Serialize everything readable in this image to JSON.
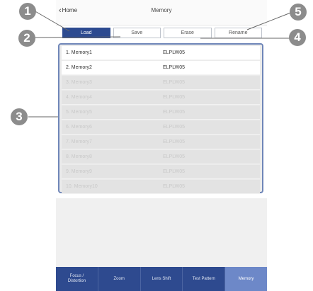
{
  "header": {
    "back_label": "Home",
    "title": "Memory"
  },
  "tabs": [
    {
      "label": "Load",
      "active": true
    },
    {
      "label": "Save",
      "active": false
    },
    {
      "label": "Erase",
      "active": false
    },
    {
      "label": "Rename",
      "active": false
    }
  ],
  "memory_list": [
    {
      "name": "1. Memory1",
      "value": "ELPLW05",
      "state": "active"
    },
    {
      "name": "2. Memory2",
      "value": "ELPLW05",
      "state": "active"
    },
    {
      "name": "3. Memory3",
      "value": "ELPLW05",
      "state": "dim"
    },
    {
      "name": "4. Memory4",
      "value": "ELPLW05",
      "state": "dim"
    },
    {
      "name": "5. Memory5",
      "value": "ELPLW05",
      "state": "dim"
    },
    {
      "name": "6. Memory6",
      "value": "ELPLW05",
      "state": "dim"
    },
    {
      "name": "7. Memory7",
      "value": "ELPLW05",
      "state": "dim"
    },
    {
      "name": "8. Memory8",
      "value": "ELPLW05",
      "state": "dim"
    },
    {
      "name": "9. Memory9",
      "value": "ELPLW05",
      "state": "dim"
    },
    {
      "name": "10. Memory10",
      "value": "ELPLW05",
      "state": "dim"
    }
  ],
  "bottom_nav": [
    {
      "label": "Focus /\nDistortion",
      "active": false
    },
    {
      "label": "Zoom",
      "active": false
    },
    {
      "label": "Lens Shift",
      "active": false
    },
    {
      "label": "Test Pattern",
      "active": false
    },
    {
      "label": "Memory",
      "active": true
    }
  ],
  "callouts": [
    "1",
    "2",
    "3",
    "4",
    "5"
  ],
  "colors": {
    "accent": "#2c4a90",
    "nav_active": "#6d88c8",
    "callout": "#8c8c8c",
    "list_border": "#6f86b8"
  }
}
